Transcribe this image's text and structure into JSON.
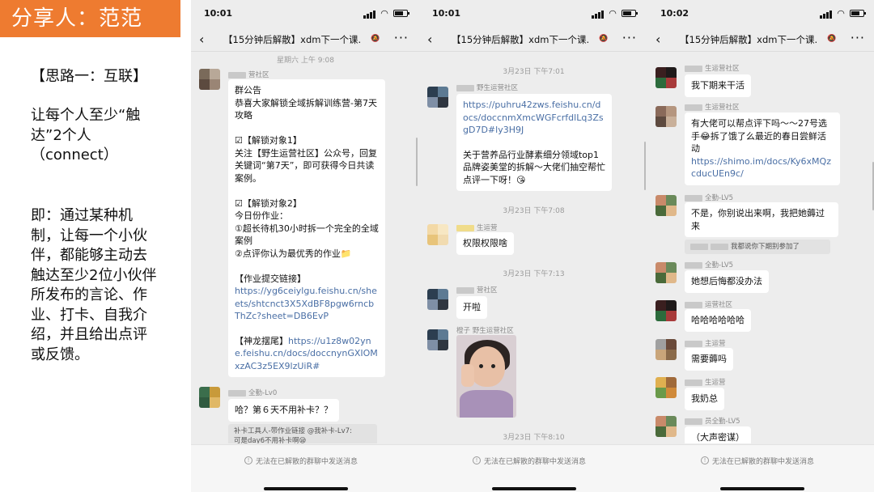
{
  "slide": {
    "title": "分享人：范范",
    "idea_heading": "【思路一：互联】",
    "idea_line": "让每个人至少“触达”2个人（connect）",
    "explanation": "即：通过某种机制，让每一个小伙伴，都能够主动去触达至少2位小伙伴所发布的言论、作业、打卡、自我介绍，并且给出点评或反馈。"
  },
  "phones": [
    {
      "time": "10:01",
      "chat_title": "【15分钟后解散】xdm下一个课...",
      "timestamp1": "星期六 上午 9:08",
      "msg1_sender": "营社区",
      "msg1_text": "群公告\n恭喜大家解锁全域拆解训练营-第7天攻略\n\n☑【解锁对象1】\n关注【野生运营社区】公众号，回复关键词“第7天”，即可获得今日共读案例。\n\n☑【解锁对象2】\n今日份作业：\n①超长待机30小时拆一个完全的全域案例\n②点评你认为最优秀的作业📁\n\n【作业提交链接】",
      "msg1_link1": "https://yg6ceiylgu.feishu.cn/sheets/shtcnct3X5XdBF8pgw6rncbThZc?sheet=DB6EvP",
      "msg1_tail": "【神龙摆尾】",
      "msg1_link2": "https://u1z8w02yne.feishu.cn/docs/doccnynGXIOMxzAC3z5EX9lzUiR#",
      "msg2_sender": "全勤-Lv0",
      "msg2_text": "哈？第６天不用补卡？？",
      "quote": "补卡工具人-带作业链接 @我补卡-Lv7:\n可是day6不用补卡啊😪",
      "footer": "无法在已解散的群聊中发送消息"
    },
    {
      "time": "10:01",
      "chat_title": "【15分钟后解散】xdm下一个课...",
      "timestamp1": "3月23日 下午7:01",
      "msg1_sender": "野生运营社区",
      "msg1_link": "https://puhru42zws.feishu.cn/docs/doccnmXmcWGFcrfdlLq3ZsgD7D#ly3H9J",
      "msg1_text": "关于营养品行业酵素细分领域top1品牌姿美堂的拆解～大佬们抽空帮忙点评一下呀！😘",
      "timestamp2": "3月23日 下午7:08",
      "msg2_sender": "生运营",
      "msg2_text": "权限权限啥",
      "timestamp3": "3月23日 下午7:13",
      "msg3_sender": "营社区",
      "msg3_text": "开啦",
      "msg4_sender": "橙子 野生运营社区",
      "timestamp4": "3月23日 下午8:10",
      "footer": "无法在已解散的群聊中发送消息"
    },
    {
      "time": "10:02",
      "chat_title": "【15分钟后解散】xdm下一个课...",
      "msg0_sender": "生运营社区",
      "msg0_text": "我下期来干活",
      "msg1_sender": "生运营社区",
      "msg1_text": "有大佬可以帮点评下吗～～27号选手😂拆了饿了么最近的春日尝鲜活动",
      "msg1_link": "https://shimo.im/docs/Ky6xMQzcducUEn9c/",
      "msg2_sender": "全勤-LV5",
      "msg2_text": "不是，你别说出来啊，我把她薅过来",
      "quote": "我都说你下期别参加了",
      "msg3_sender": "全勤-LV5",
      "msg3_text": "她想后悔都没办法",
      "msg4_sender": "运营社区",
      "msg4_text": "哈哈哈哈哈哈",
      "msg5_sender": "主运营",
      "msg5_text": "需要薅吗",
      "msg6_sender": "生运营",
      "msg6_text": "我奶总",
      "msg7_sender": "员全勤-LV5",
      "msg7_text": "（大声密谋）",
      "footer": "无法在已解散的群聊中发送消息"
    }
  ]
}
